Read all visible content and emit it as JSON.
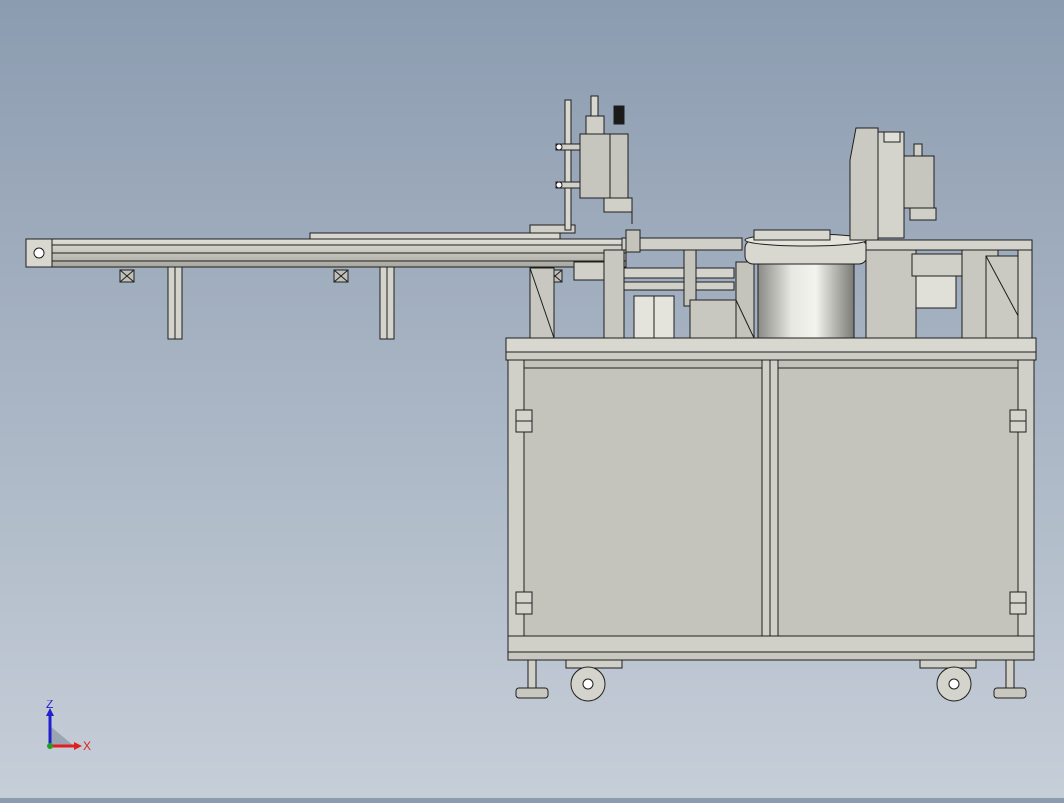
{
  "viewport": {
    "background_top": "#8c9cb0",
    "background_bottom": "#c6ced8",
    "part_fill": "#c8c8c0",
    "part_stroke": "#1e1e1e"
  },
  "triad": {
    "z_label": "Z",
    "x_label": "X",
    "z_color": "#2020d0",
    "x_color": "#e02020",
    "y_color": "#20a020"
  }
}
